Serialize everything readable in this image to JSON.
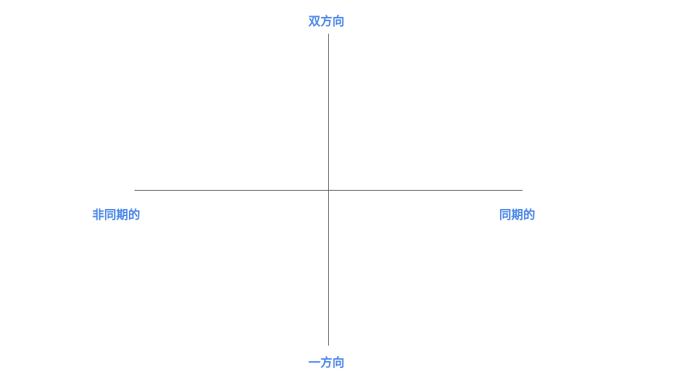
{
  "labels": {
    "top": "双方向",
    "bottom": "一方向",
    "left": "非同期的",
    "right": "同期的"
  },
  "colors": {
    "label": "#4a86e8",
    "axis": "#555555"
  }
}
